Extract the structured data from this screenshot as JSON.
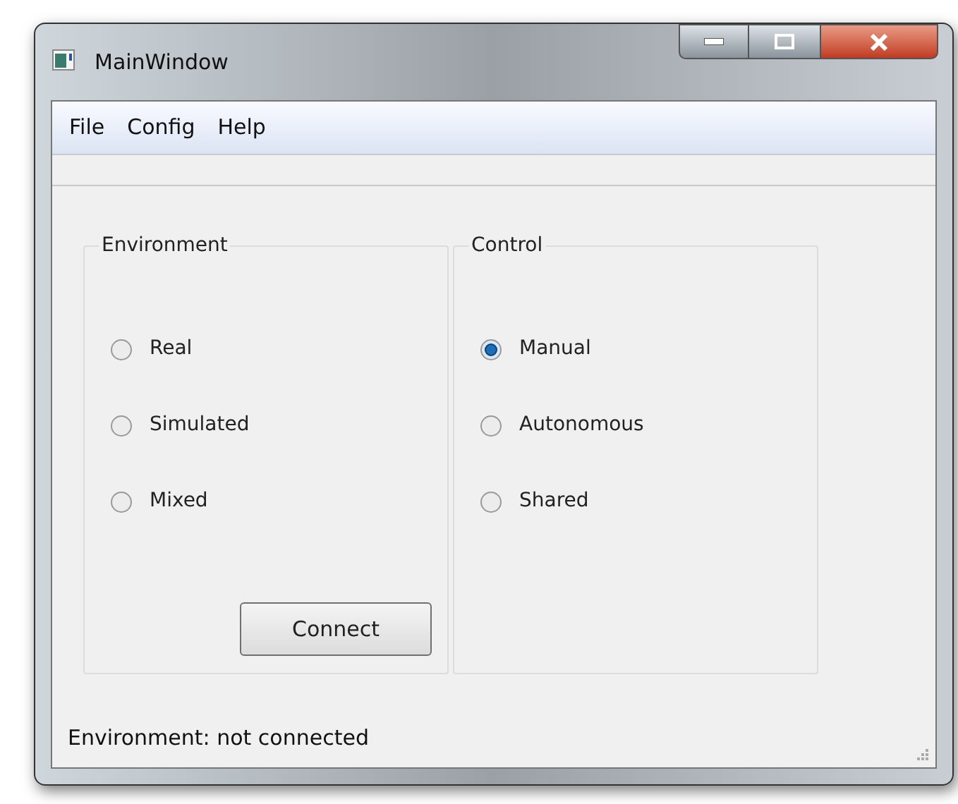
{
  "window": {
    "title": "MainWindow"
  },
  "menu": [
    "File",
    "Config",
    "Help"
  ],
  "groups": [
    {
      "title": "Environment",
      "options": [
        {
          "label": "Real",
          "selected": false
        },
        {
          "label": "Simulated",
          "selected": false
        },
        {
          "label": "Mixed",
          "selected": false
        }
      ],
      "button": "Connect"
    },
    {
      "title": "Control",
      "options": [
        {
          "label": "Manual",
          "selected": true
        },
        {
          "label": "Autonomous",
          "selected": false
        },
        {
          "label": "Shared",
          "selected": false
        }
      ]
    }
  ],
  "status_bar": "Environment: not connected"
}
